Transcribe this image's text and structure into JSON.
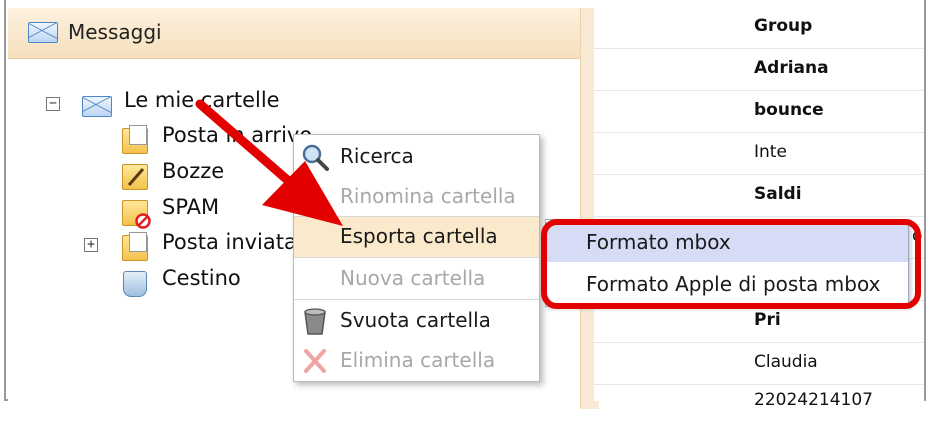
{
  "panel": {
    "title": "Messaggi"
  },
  "tree": {
    "root": {
      "expander": "−",
      "label": "Le mie cartelle"
    },
    "items": [
      {
        "label": "Posta in arrivo",
        "icon": "inbox-folder-icon"
      },
      {
        "label": "Bozze",
        "icon": "drafts-folder-icon"
      },
      {
        "label": "SPAM",
        "icon": "spam-folder-icon"
      },
      {
        "label": "Posta inviata",
        "icon": "sent-folder-icon",
        "expander": "+"
      },
      {
        "label": "Cestino",
        "icon": "trash-icon"
      }
    ]
  },
  "context_menu": {
    "items": [
      {
        "label": "Ricerca",
        "icon": "magnifier-icon",
        "enabled": true
      },
      {
        "label": "Rinomina cartella",
        "enabled": false
      },
      {
        "label": "Esporta cartella",
        "enabled": true,
        "highlighted": true
      },
      {
        "label": "Nuova cartella",
        "enabled": false
      },
      {
        "label": "Svuota cartella",
        "icon": "bucket-icon",
        "enabled": true
      },
      {
        "label": "Elimina cartella",
        "icon": "delete-x-icon",
        "enabled": false
      }
    ]
  },
  "submenu": {
    "items": [
      {
        "label": "Formato mbox",
        "highlighted": true
      },
      {
        "label": "Formato Apple di posta mbox"
      }
    ]
  },
  "message_list": {
    "rows": [
      {
        "text": "Group",
        "bold": true
      },
      {
        "text": "Adriana",
        "bold": true
      },
      {
        "text": "bounce",
        "bold": true
      },
      {
        "text": "Inte",
        "bold": false
      },
      {
        "text": "Saldi",
        "bold": true
      },
      {
        "text": "",
        "bold": false
      },
      {
        "text": "",
        "bold": false
      },
      {
        "text": "Pri",
        "bold": true
      },
      {
        "text": "Claudia",
        "bold": false
      },
      {
        "text": "22024214107",
        "bold": false
      }
    ],
    "partial_char": "o"
  },
  "annotation": {
    "arrow_color": "#e30000",
    "highlight_box_color": "#e30000"
  }
}
